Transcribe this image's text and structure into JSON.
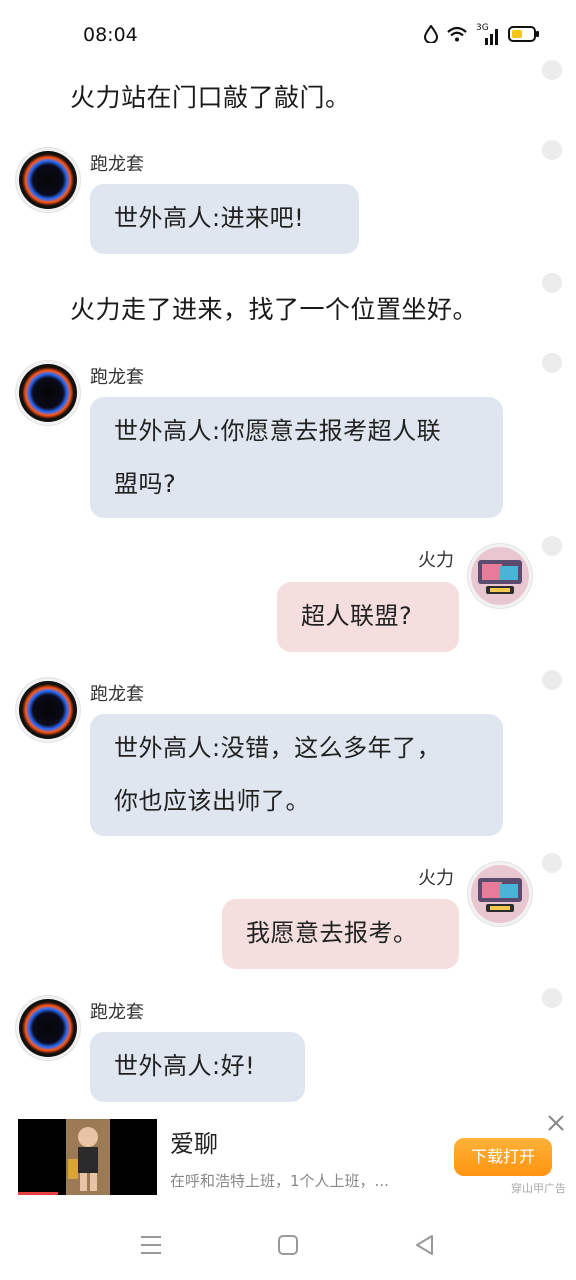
{
  "status_bar": {
    "time": "08:04",
    "network": "3G",
    "icons": [
      "water-drop-icon",
      "wifi-icon",
      "signal-icon",
      "battery-icon"
    ],
    "battery_color": "#f5c518"
  },
  "messages": [
    {
      "type": "narration",
      "text": "火力站在门口敲了敲门。"
    },
    {
      "type": "left",
      "name": "跑龙套",
      "lines": [
        "世外高人:进来吧!"
      ]
    },
    {
      "type": "narration",
      "text": "火力走了进来，找了一个位置坐好。"
    },
    {
      "type": "left",
      "name": "跑龙套",
      "lines": [
        "世外高人:你愿意去报考超人联",
        "盟吗?"
      ]
    },
    {
      "type": "right",
      "name": "火力",
      "lines": [
        "超人联盟?"
      ]
    },
    {
      "type": "left",
      "name": "跑龙套",
      "lines": [
        "世外高人:没错，这么多年了，",
        "你也应该出师了。"
      ]
    },
    {
      "type": "right",
      "name": "火力",
      "lines": [
        "我愿意去报考。"
      ]
    },
    {
      "type": "left",
      "name": "跑龙套",
      "lines": [
        "世外高人:好!"
      ]
    }
  ],
  "ad": {
    "title": "爱聊",
    "description": "在呼和浩特上班，1个人上班，...",
    "button_label": "下载打开",
    "source": "穿山甲广告"
  },
  "colors": {
    "left_bubble": "#dfe6ef",
    "right_bubble": "#f4dede",
    "ad_button": "#ff9a14"
  },
  "nav": {
    "icons": [
      "menu-icon",
      "home-square-icon",
      "back-triangle-icon"
    ]
  }
}
